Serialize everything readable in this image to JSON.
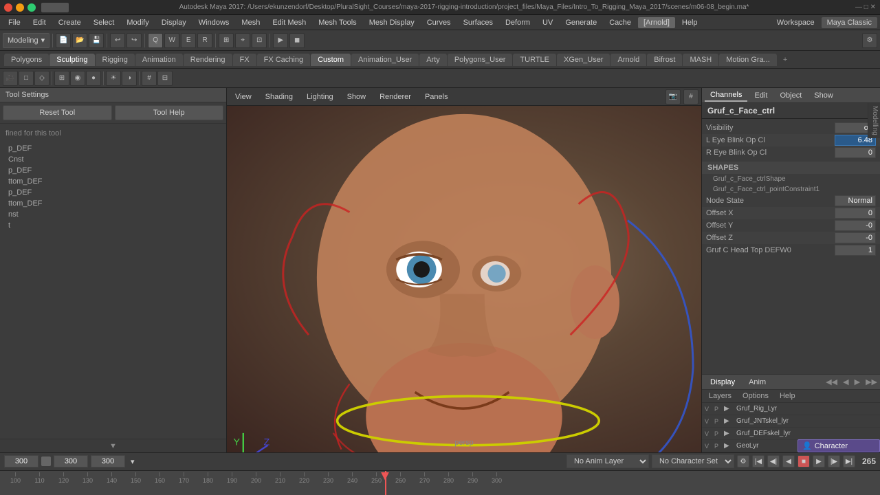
{
  "titlebar": {
    "title": "Autodesk Maya 2017: /Users/ekunzendorf/Desktop/PluralSight_Courses/maya-2017-rigging-introduction/project_files/Maya_Files/Intro_To_Rigging_Maya_2017/scenes/m06-08_begin.ma*"
  },
  "menubar": {
    "items": [
      "File",
      "Edit",
      "Create",
      "Select",
      "Modify",
      "Display",
      "Windows",
      "Mesh",
      "Edit Mesh",
      "Mesh Tools",
      "Mesh Display",
      "Curves",
      "Surfaces",
      "Deform",
      "UV",
      "Generate",
      "Cache",
      "Arnold",
      "Help"
    ]
  },
  "workspace": {
    "label": "Workspace",
    "value": "Maya Classic"
  },
  "toolbar": {
    "dropdown": "Modeling"
  },
  "tabs": {
    "items": [
      "Polygons",
      "Sculpting",
      "Rigging",
      "Animation",
      "Rendering",
      "FX",
      "FX Caching",
      "Custom",
      "Animation_User",
      "Arty",
      "Polygons_User",
      "TURTLE",
      "XGen_User",
      "Arnold",
      "Bifrost",
      "MASH",
      "Motion Gra..."
    ],
    "active": "Rigging"
  },
  "viewport": {
    "menus": [
      "View",
      "Shading",
      "Lighting",
      "Show",
      "Renderer",
      "Panels"
    ],
    "persp_label": "persp"
  },
  "tool_settings": {
    "header": "Tool Settings",
    "reset_btn": "Reset Tool",
    "help_btn": "Tool Help",
    "info": "fined for this tool"
  },
  "node_list": {
    "items": [
      {
        "label": "p_DEF"
      },
      {
        "label": "Cnst"
      },
      {
        "label": "p_DEF"
      },
      {
        "label": "ttom_DEF"
      },
      {
        "label": "p_DEF"
      },
      {
        "label": "ttom_DEF"
      },
      {
        "label": "nst"
      },
      {
        "label": "t"
      }
    ]
  },
  "channels": {
    "tabs": [
      "Channels",
      "Edit",
      "Object",
      "Show"
    ],
    "node_name": "Gruf_c_Face_ctrl",
    "visibility_label": "Visibility",
    "visibility_value": "on",
    "attrs": [
      {
        "label": "L Eye Blink Op Cl",
        "value": "6.48",
        "highlight": true
      },
      {
        "label": "R Eye Blink Op Cl",
        "value": "0",
        "highlight": false
      }
    ],
    "shapes_header": "SHAPES",
    "shapes": [
      "Gruf_c_Face_ctrlShape",
      "Gruf_c_Face_ctrl_pointConstraint1"
    ],
    "node_attrs": [
      {
        "label": "Node State",
        "value": "Normal"
      },
      {
        "label": "Offset X",
        "value": "0"
      },
      {
        "label": "Offset Y",
        "value": "-0"
      },
      {
        "label": "Offset Z",
        "value": "-0"
      },
      {
        "label": "Gruf C Head Top DEFW0",
        "value": "1"
      }
    ]
  },
  "layers": {
    "tabs": [
      "Display",
      "Anim"
    ],
    "active": "Display",
    "options": [
      "Layers",
      "Options",
      "Help"
    ],
    "layer_items": [
      {
        "vp": "V",
        "p": "P",
        "name": "Gruf_Rig_Lyr"
      },
      {
        "vp": "V",
        "p": "P",
        "name": "Gruf_JNTskel_lyr"
      },
      {
        "vp": "V",
        "p": "P",
        "name": "Gruf_DEFskel_lyr"
      },
      {
        "vp": "V",
        "p": "P",
        "name": "GeoLyr"
      }
    ]
  },
  "playback": {
    "time_fields": [
      "300",
      "300",
      "300"
    ],
    "anim_layer": "No Anim Layer",
    "char_set": "No Character Set",
    "current_frame": "265"
  },
  "timeline": {
    "ticks": [
      100,
      110,
      120,
      130,
      140,
      150,
      160,
      170,
      180,
      190,
      200,
      210,
      220,
      230,
      240,
      250,
      260,
      270,
      280,
      290,
      300
    ],
    "playhead_frame": 265
  },
  "character_label": "Character"
}
